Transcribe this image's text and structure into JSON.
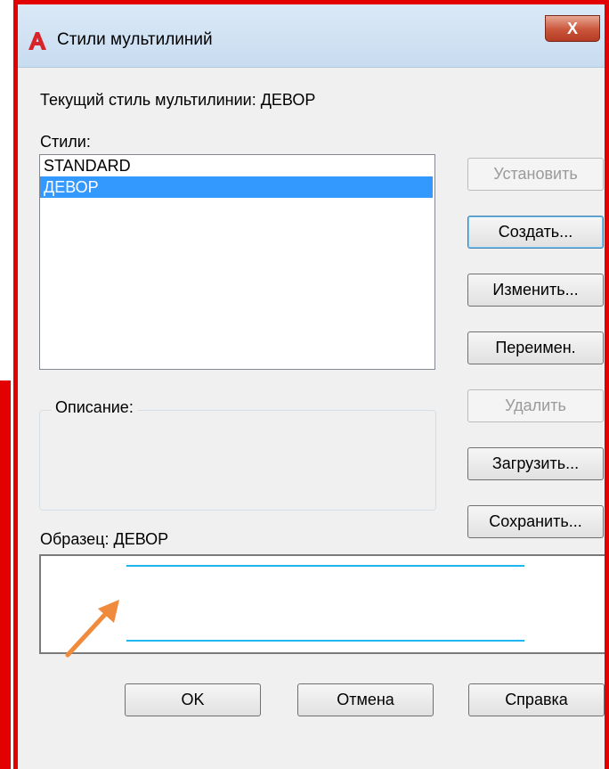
{
  "window": {
    "title": "Стили мультилиний",
    "close_glyph": "X",
    "app_icon": "autocad-icon"
  },
  "current_style": {
    "text": "Текущий стиль мультилинии: ДЕВОР"
  },
  "styles": {
    "label": "Стили:",
    "items": [
      "STANDARD",
      "ДЕВОР"
    ],
    "selected_index": 1
  },
  "description": {
    "label": "Описание:",
    "value": ""
  },
  "preview": {
    "label": "Образец: ДЕВОР",
    "line_color": "#1fb6f0"
  },
  "side_buttons": {
    "set_current": "Установить",
    "create": "Создать...",
    "modify": "Изменить...",
    "rename": "Переимен.",
    "delete": "Удалить",
    "load": "Загрузить...",
    "save": "Сохранить..."
  },
  "bottom_buttons": {
    "ok": "OK",
    "cancel": "Отмена",
    "help": "Справка"
  },
  "annotations": {
    "highlight_color": "#e30000",
    "arrow_color": "#f08a3c"
  }
}
